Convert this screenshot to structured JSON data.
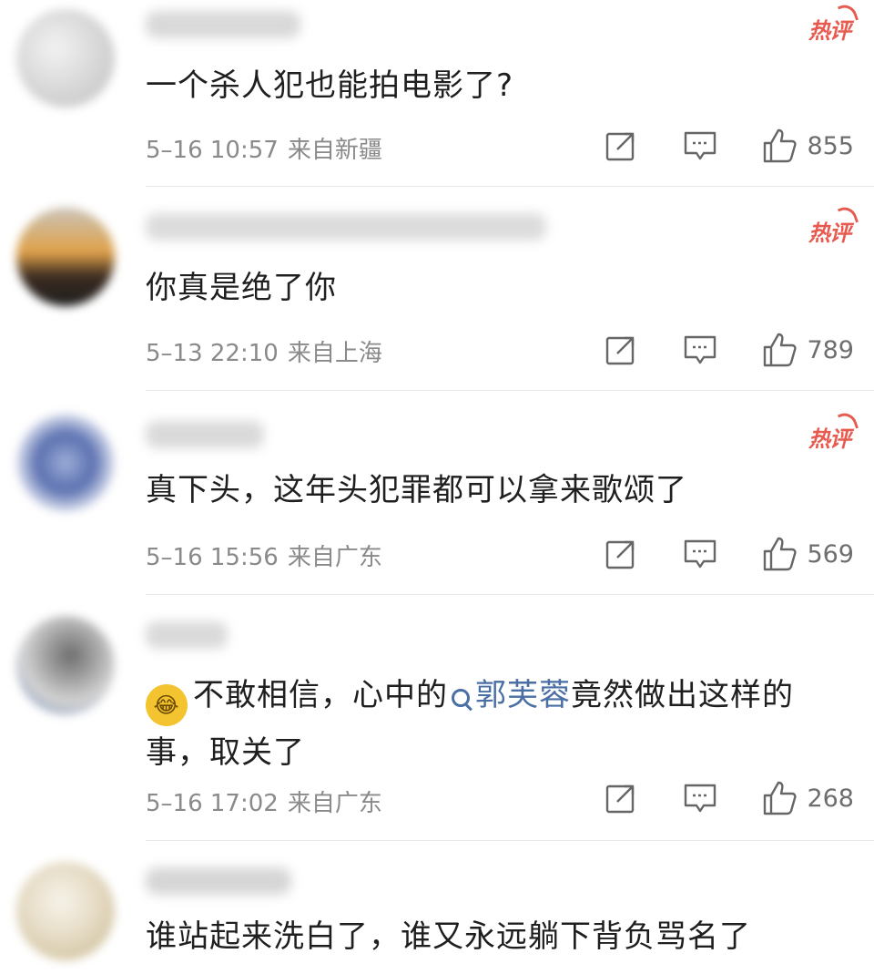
{
  "comments": [
    {
      "username": "",
      "hot_badge": "热评",
      "text": "一个杀人犯也能拍电影了?",
      "date_time": "5–16 10:57",
      "location": "来自新疆",
      "likes": "855"
    },
    {
      "username": "",
      "hot_badge": "热评",
      "text": "你真是绝了你",
      "date_time": "5–13 22:10",
      "location": "来自上海",
      "likes": "789"
    },
    {
      "username": "",
      "hot_badge": "热评",
      "text": "真下头，这年头犯罪都可以拿来歌颂了",
      "date_time": "5–16 15:56",
      "location": "来自广东",
      "likes": "569"
    },
    {
      "username": "",
      "text_before": "不敢相信，心中的",
      "topic": "郭芙蓉",
      "text_after": "竟然做出这样的事，取关了",
      "emoji": "laugh-cry-emoji",
      "date_time": "5–16 17:02",
      "location": "来自广东",
      "likes": "268"
    },
    {
      "username": "",
      "text": "谁站起来洗白了，谁又永远躺下背负骂名了"
    }
  ],
  "icons": {
    "share": "share-icon",
    "comment": "comment-icon",
    "like": "thumbs-up-icon"
  },
  "colors": {
    "hot_badge": "#e85a4f",
    "topic_link": "#4a6fa5",
    "meta_text": "#8a8a8a",
    "icon": "#666666"
  }
}
